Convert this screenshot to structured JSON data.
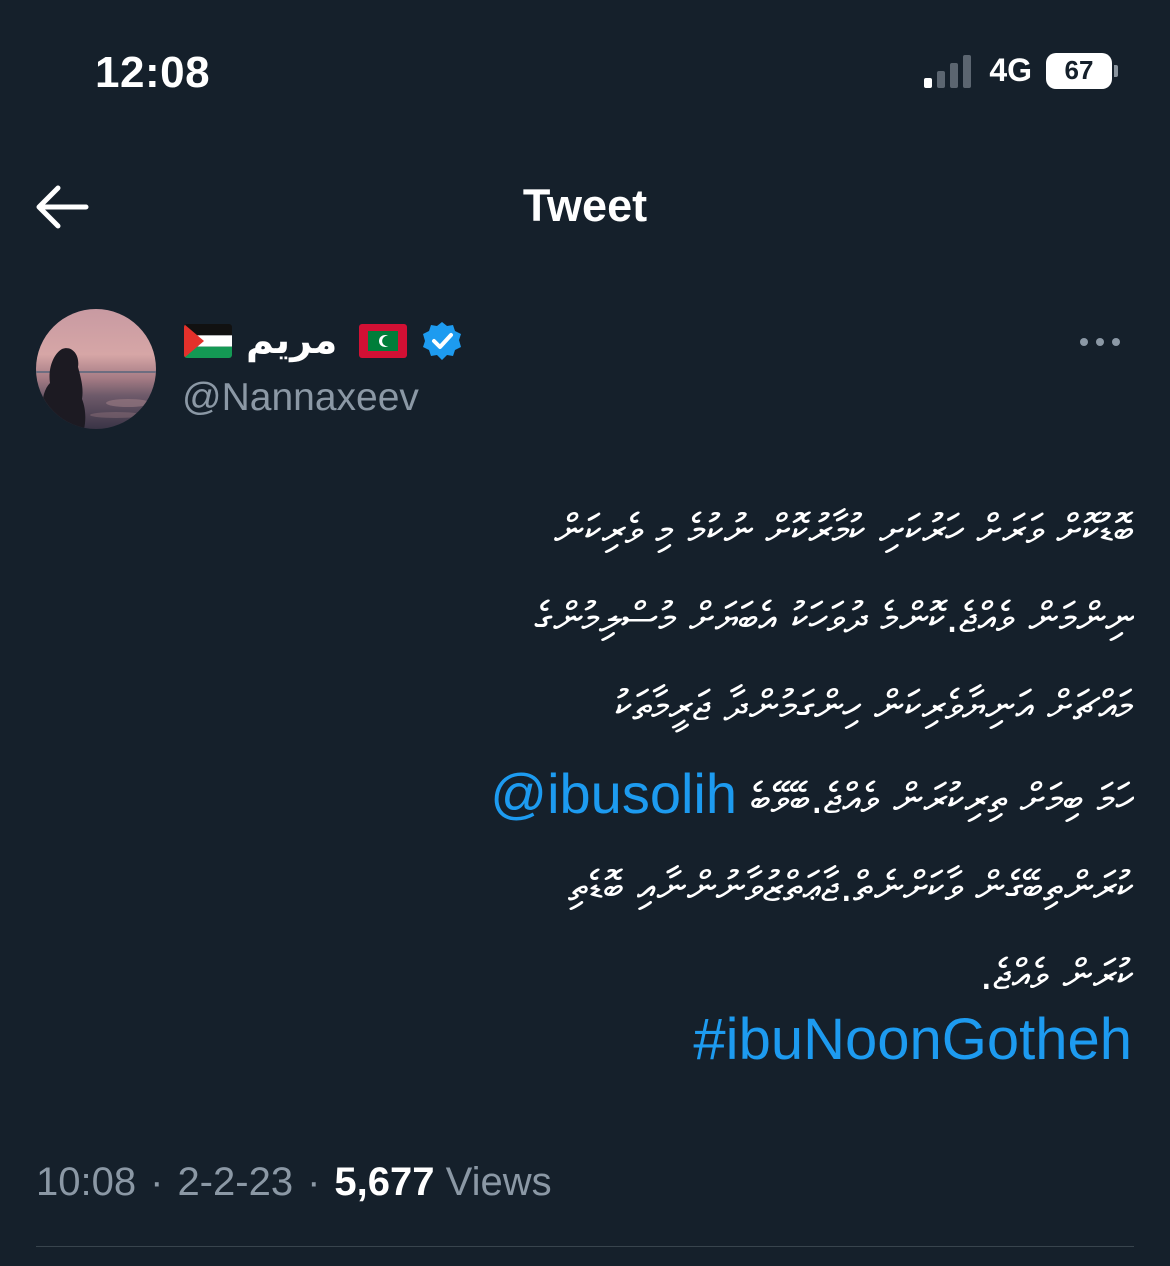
{
  "status_bar": {
    "time": "12:08",
    "network": "4G",
    "battery": "67"
  },
  "header": {
    "title": "Tweet",
    "back_icon": "arrow-left-icon"
  },
  "author": {
    "display_name": "مريم",
    "username": "@Nannaxeev",
    "verified": true,
    "flags": [
      "palestine-flag",
      "maldives-flag"
    ]
  },
  "tweet": {
    "lines": [
      "ބޮޑުކޮށް ވަރަށް ހަރުކަށި ކުމާރުކޮށް ނުކުމެ މި ވެރިކަން",
      "ނިންމަން ވެއްޖެ.ކޮންމެ ދުވަހަކު އެބަޔަށް މުސްލިމުންގެ",
      "މައްޗަށް އަނިޔާވެރިކަން ހިންގަމުންދާ ޖަރީމާތަކު",
      "ކުރަން ވެއްޖެ.ބޭވޭބެ"
    ],
    "mention": "@ibusolih",
    "mention_suffix": "ހަމަ ބިމަށް ތިރިކުރަން ވެއްޖެ.ބޭވޭބެ",
    "lines_after": [
      "ކުރަންތިބޭގެން ވާކަށްނެތް.ޖާޢަތްޒުވާނުންނާއި ބޮޑެތި",
      "ކުރަން ވެއްޖެ."
    ],
    "hashtag": "#ibuNoonGotheh"
  },
  "meta": {
    "time": "10:08",
    "date": "2-2-23",
    "views_count": "5,677",
    "views_label": "Views"
  },
  "colors": {
    "background": "#15202b",
    "accent": "#1d9bf0",
    "muted": "#8b98a5"
  }
}
